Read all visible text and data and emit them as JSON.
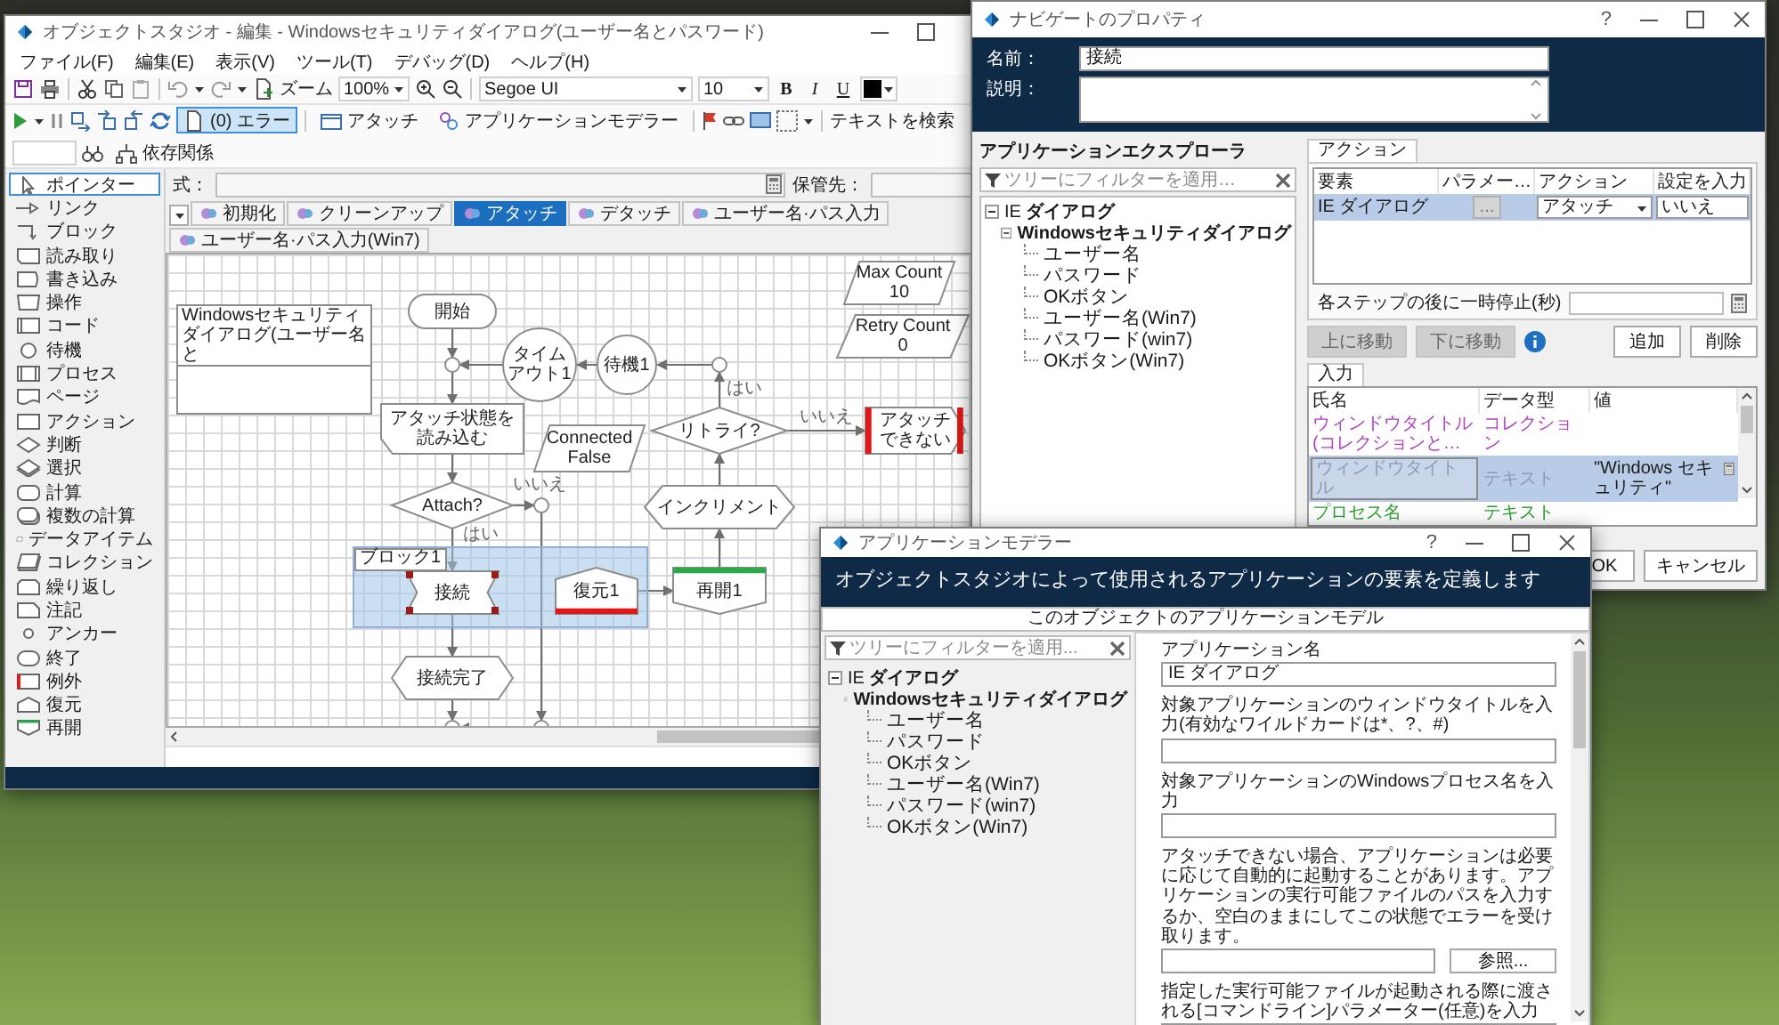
{
  "object_studio": {
    "title": "オブジェクトスタジオ - 編集 - Windowsセキュリティダイアログ(ユーザー名とパスワード)",
    "menu": [
      "ファイル(F)",
      "編集(E)",
      "表示(V)",
      "ツール(T)",
      "デバッグ(D)",
      "ヘルプ(H)"
    ],
    "toolbar_1": {
      "zoom_label": "ズーム",
      "zoom": "100%",
      "font": "Segoe UI",
      "font_size": "10",
      "bold": "B",
      "italic": "I",
      "underline": "U"
    },
    "toolbar_2": {
      "errors": {
        "label": "(0) エラー",
        "selected": true
      },
      "attach": "アタッチ",
      "app_modeller": "アプリケーションモデラー",
      "search_label": "テキストを検索",
      "dependencies": "依存関係"
    },
    "expression_label": "式：",
    "store_label": "保管先：",
    "palette": [
      {
        "kind": "pointer",
        "label": "ポインター",
        "selected": true
      },
      {
        "kind": "link",
        "label": "リンク",
        "selected": false
      },
      {
        "kind": "block",
        "label": "ブロック",
        "selected": false
      },
      {
        "kind": "read",
        "label": "読み取り",
        "selected": false
      },
      {
        "kind": "write",
        "label": "書き込み",
        "selected": false
      },
      {
        "kind": "operation",
        "label": "操作",
        "selected": false
      },
      {
        "kind": "code",
        "label": "コード",
        "selected": false
      },
      {
        "kind": "wait",
        "label": "待機",
        "selected": false
      },
      {
        "kind": "process",
        "label": "プロセス",
        "selected": false
      },
      {
        "kind": "page",
        "label": "ページ",
        "selected": false
      },
      {
        "kind": "action",
        "label": "アクション",
        "selected": false
      },
      {
        "kind": "decision",
        "label": "判断",
        "selected": false
      },
      {
        "kind": "choice",
        "label": "選択",
        "selected": false
      },
      {
        "kind": "calculation",
        "label": "計算",
        "selected": false
      },
      {
        "kind": "multi",
        "label": "複数の計算",
        "selected": false
      },
      {
        "kind": "data",
        "label": "データアイテム",
        "selected": false
      },
      {
        "kind": "collection",
        "label": "コレクション",
        "selected": false
      },
      {
        "kind": "loop",
        "label": "繰り返し",
        "selected": false
      },
      {
        "kind": "note",
        "label": "注記",
        "selected": false
      },
      {
        "kind": "anchor",
        "label": "アンカー",
        "selected": false
      },
      {
        "kind": "end",
        "label": "終了",
        "selected": false
      },
      {
        "kind": "exception",
        "label": "例外",
        "selected": false
      },
      {
        "kind": "recover",
        "label": "復元",
        "selected": false
      },
      {
        "kind": "resume",
        "label": "再開",
        "selected": false
      }
    ],
    "tabs": [
      {
        "label": "初期化",
        "selected": false
      },
      {
        "label": "クリーンアップ",
        "selected": false
      },
      {
        "label": "アタッチ",
        "selected": true
      },
      {
        "label": "デタッチ",
        "selected": false
      },
      {
        "label": "ユーザー名·パス入力",
        "selected": false
      },
      {
        "label": "ユーザー名·パス入力(Win7)",
        "selected": false
      }
    ],
    "canvas": {
      "nodes": [
        {
          "kind": "data",
          "label": "Max Count",
          "value": "10",
          "selected": false
        },
        {
          "kind": "start",
          "label": "開始",
          "selected": false
        },
        {
          "kind": "note",
          "label": "Windowsセキュリティダイアログ(ユーザー名と",
          "selected": false
        },
        {
          "kind": "data",
          "label": "Retry Count",
          "value": "0",
          "selected": false
        },
        {
          "kind": "wait",
          "label": "タイムアウト1",
          "selected": false
        },
        {
          "kind": "wait",
          "label": "待機1",
          "selected": false
        },
        {
          "kind": "read",
          "label": "アタッチ状態を読み込む",
          "selected": false
        },
        {
          "kind": "data",
          "label": "Connected",
          "value": "False",
          "selected": false
        },
        {
          "kind": "decision",
          "label": "リトライ?",
          "selected": false
        },
        {
          "kind": "exception",
          "label": "アタッチできない",
          "selected": false
        },
        {
          "kind": "decision",
          "label": "Attach?",
          "selected": false
        },
        {
          "kind": "calculation",
          "label": "インクリメント",
          "selected": false
        },
        {
          "kind": "block",
          "label": "ブロック1",
          "selected": false
        },
        {
          "kind": "navigate",
          "label": "接続",
          "selected": true
        },
        {
          "kind": "recover",
          "label": "復元1",
          "selected": false
        },
        {
          "kind": "resume",
          "label": "再開1",
          "selected": false
        },
        {
          "kind": "calculation",
          "label": "接続完了",
          "selected": false
        }
      ],
      "branch_labels": [
        "いいえ",
        "はい",
        "はい",
        "いいえ"
      ]
    }
  },
  "navigate_properties": {
    "title": "ナビゲートのプロパティ",
    "help": "?",
    "name_label": "名前：",
    "name_value": "接続",
    "description_label": "説明：",
    "explorer_title": "アプリケーションエクスプローラ",
    "filter_placeholder": "ツリーにフィルターを適用…",
    "tree": [
      {
        "label": "IE **ダイアログ**",
        "expanded": true,
        "children": [
          {
            "label": "Windowsセキュリティダイアログ",
            "expanded": true,
            "children": [
              {
                "label": "ユーザー名"
              },
              {
                "label": "パスワード"
              },
              {
                "label": "OKボタン"
              },
              {
                "label": "ユーザー名(Win7)"
              },
              {
                "label": "パスワード(win7)"
              },
              {
                "label": "OKボタン(Win7)"
              }
            ]
          }
        ]
      }
    ],
    "actions_tab": "アクション",
    "action_columns": [
      "要素",
      "パラメー…",
      "アクション",
      "設定を入力"
    ],
    "action_rows": [
      {
        "element": "IE ダイアログ",
        "parameters": "...",
        "action": "アタッチ",
        "input": "いいえ",
        "selected": true
      }
    ],
    "pause_label": "各ステップの後に一時停止(秒)",
    "move_buttons": [
      {
        "label": "上に移動",
        "disabled": true
      },
      {
        "label": "下に移動",
        "disabled": true
      }
    ],
    "edit_buttons": [
      {
        "label": "追加",
        "disabled": false
      },
      {
        "label": "削除",
        "disabled": false
      }
    ],
    "inputs_tab": "入力",
    "input_columns": [
      "氏名",
      "データ型",
      "値"
    ],
    "input_rows": [
      {
        "name": "ウィンドウタイトル(コレクションと…",
        "type": "コレクション",
        "color": "#b040c0",
        "selected": false
      },
      {
        "name": "ウィンドウタイトル",
        "type": "テキスト",
        "value": "\"Windows セキュリティ\"",
        "color": "#8c9ab4",
        "selected": true
      },
      {
        "name": "プロセス名",
        "type": "テキスト",
        "color": "#2ea02e",
        "selected": false
      }
    ],
    "ok": "OK",
    "cancel": "キャンセル"
  },
  "application_modeller": {
    "title": "アプリケーションモデラー",
    "help": "?",
    "heading": "オブジェクトスタジオによって使用されるアプリケーションの要素を定義します",
    "subtitle": "このオブジェクトのアプリケーションモデル",
    "filter_placeholder": "ツリーにフィルターを適用...",
    "tree": [
      {
        "label": "IE **ダイアログ**",
        "expanded": true,
        "children": [
          {
            "label": "Windowsセキュリティダイアログ",
            "expanded": true,
            "children": [
              {
                "label": "ユーザー名"
              },
              {
                "label": "パスワード"
              },
              {
                "label": "OKボタン"
              },
              {
                "label": "ユーザー名(Win7)"
              },
              {
                "label": "パスワード(win7)"
              },
              {
                "label": "OKボタン(Win7)"
              }
            ]
          }
        ]
      }
    ],
    "fields": [
      {
        "label": "アプリケーション名",
        "value": "IE ダイアログ"
      },
      {
        "label": "対象アプリケーションのウィンドウタイトルを入力(有効なワイルドカードは*、?、#)"
      },
      {
        "label": "対象アプリケーションのWindowsプロセス名を入力"
      },
      {
        "label": "アタッチできない場合、アプリケーションは必要に応じて自動的に起動することがあります。アプリケーションの実行可能ファイルのパスを入力するか、空白のままにしてこの状態でエラーを受け取ります。",
        "button": "参照..."
      },
      {
        "label": "指定した実行可能ファイルが起動される際に渡される[コマンドライン]パラメーター(任意)を入力"
      }
    ]
  }
}
